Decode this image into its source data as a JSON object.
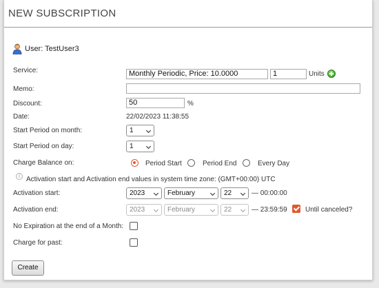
{
  "title": "NEW SUBSCRIPTION",
  "user": {
    "label": "User: TestUser3"
  },
  "service": {
    "label": "Service:",
    "value": "Monthly Periodic, Price: 10.0000",
    "units_value": "1",
    "units_label": "Units"
  },
  "memo": {
    "label": "Memo:",
    "value": ""
  },
  "discount": {
    "label": "Discount:",
    "value": "50",
    "suffix": "%"
  },
  "date": {
    "label": "Date:",
    "value": "22/02/2023 11:38:55"
  },
  "start_month": {
    "label": "Start Period on month:",
    "value": "1"
  },
  "start_day": {
    "label": "Start Period on day:",
    "value": "1"
  },
  "charge_balance": {
    "label": "Charge Balance on:",
    "options": [
      "Period Start",
      "Period End",
      "Every Day"
    ],
    "selected": "Period Start"
  },
  "timezone_note": "Activation start and Activation end values in system time zone: (GMT+00:00) UTC",
  "activation_start": {
    "label": "Activation start:",
    "year": "2023",
    "month": "February",
    "day": "22",
    "time": "— 00:00:00"
  },
  "activation_end": {
    "label": "Activation end:",
    "year": "2023",
    "month": "February",
    "day": "22",
    "time": "— 23:59:59",
    "until_canceled_label": "Until canceled?",
    "until_canceled": true
  },
  "no_expiration": {
    "label": "No Expiration at the end of a Month:",
    "checked": false
  },
  "charge_for_past": {
    "label": "Charge for past:",
    "checked": false
  },
  "create_button": "Create",
  "colors": {
    "accent": "#e05a2e",
    "add_icon": "#3aa52a"
  }
}
